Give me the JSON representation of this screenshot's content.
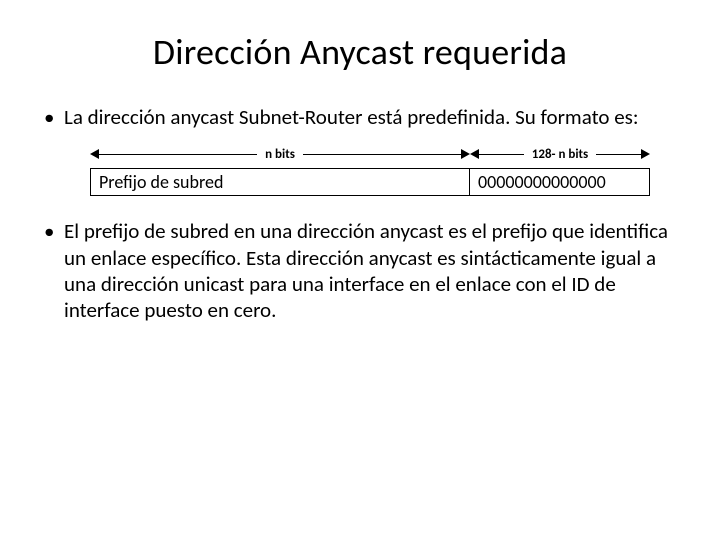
{
  "title": "Dirección Anycast requerida",
  "bullet1": "La dirección anycast  Subnet-Router está predefinida. Su formato es:",
  "diagram": {
    "label_left": "n bits",
    "label_right": "128- n bits",
    "box_left": "Prefijo de subred",
    "box_right": "00000000000000"
  },
  "bullet2": "El prefijo de subred en una dirección anycast es el prefijo que identifica un enlace específico. Esta dirección anycast es sintácticamente igual a una dirección unicast para una interface en el enlace con el ID de interface puesto en cero."
}
